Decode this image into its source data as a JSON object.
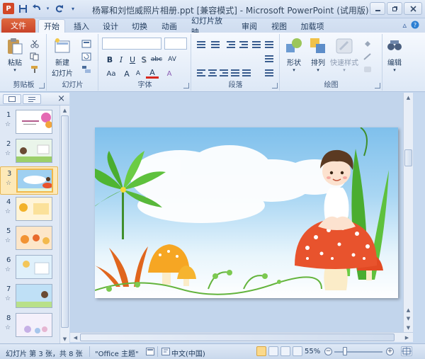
{
  "titlebar": {
    "title": "杨幂和刘恺威照片相册.ppt [兼容模式] - Microsoft PowerPoint (试用版)",
    "app_icon": "P",
    "qat_icons": [
      "save-icon",
      "undo-icon",
      "redo-icon",
      "customize-icon"
    ],
    "window_buttons": [
      "minimize",
      "restore",
      "close"
    ]
  },
  "tabs": {
    "file": "文件",
    "items": [
      "开始",
      "插入",
      "设计",
      "切换",
      "动画",
      "幻灯片放映",
      "审阅",
      "视图",
      "加载项"
    ],
    "active": "开始"
  },
  "ribbon": {
    "clipboard": {
      "label": "剪贴板",
      "paste": "粘贴"
    },
    "slides": {
      "label": "幻灯片",
      "new_slide_line1": "新建",
      "new_slide_line2": "幻灯片"
    },
    "font": {
      "label": "字体",
      "bold": "B",
      "italic": "I",
      "underline": "U",
      "shadow": "S",
      "strike": "abc",
      "spacing": "AV",
      "case": "Aa",
      "size_up": "A",
      "size_down": "A",
      "color": "A",
      "clear": "A"
    },
    "paragraph": {
      "label": "段落"
    },
    "drawing": {
      "label": "绘图",
      "shapes": "形状",
      "arrange": "排列",
      "quick_styles": "快速样式"
    },
    "editing": {
      "label": "编辑",
      "button": "编辑"
    }
  },
  "pane": {
    "tab_slides_icon": "slides-tab-icon",
    "tab_outline_icon": "outline-tab-icon",
    "close": "×",
    "thumbnails": [
      {
        "num": "1"
      },
      {
        "num": "2"
      },
      {
        "num": "3"
      },
      {
        "num": "4"
      },
      {
        "num": "5"
      },
      {
        "num": "6"
      },
      {
        "num": "7"
      },
      {
        "num": "8"
      }
    ],
    "selected": "3",
    "star": "☆"
  },
  "status": {
    "slide_info": "幻灯片 第 3 张，共 8 张",
    "theme": "\"Office 主题\"",
    "language": "中文(中国)",
    "zoom": "55%",
    "zoom_out": "−",
    "zoom_in": "+"
  },
  "colors": {
    "file_tab": "#c9432a",
    "accent": "#2b579a",
    "selection": "#fde9b8"
  }
}
